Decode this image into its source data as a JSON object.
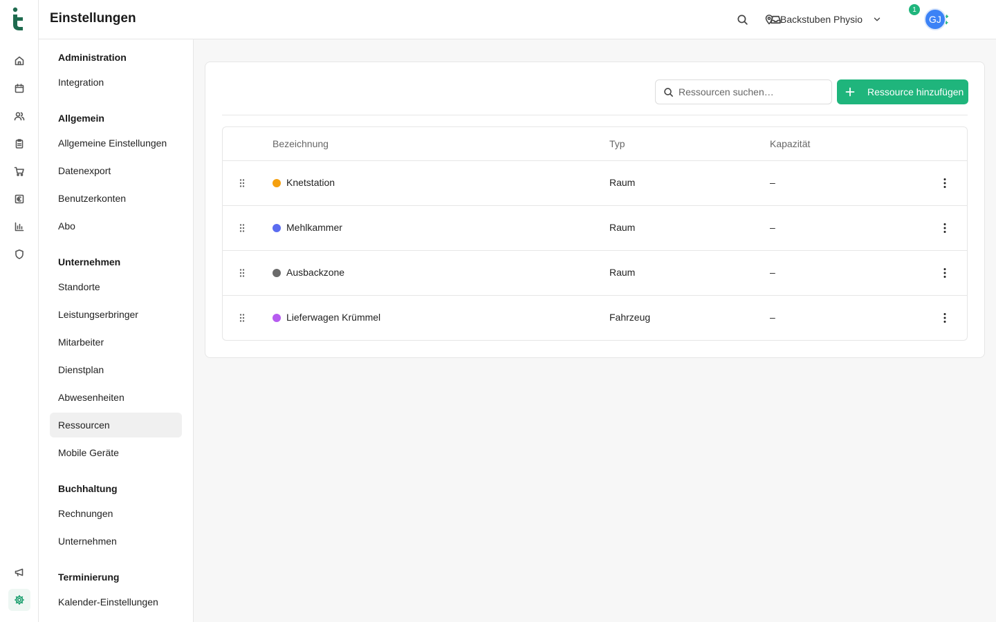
{
  "header": {
    "title": "Einstellungen",
    "location": "Backstuben Physio",
    "notification_count": "1",
    "avatar_initials": "GJ"
  },
  "rail": {
    "items": [
      "home-icon",
      "calendar-icon",
      "users-icon",
      "clipboard-icon",
      "cart-icon",
      "euro-icon",
      "chart-icon",
      "shield-icon",
      "megaphone-icon",
      "gear-icon"
    ]
  },
  "sidebar": {
    "sections": [
      {
        "title": "Administration",
        "items": [
          "Integration"
        ]
      },
      {
        "title": "Allgemein",
        "items": [
          "Allgemeine Einstellungen",
          "Datenexport",
          "Benutzerkonten",
          "Abo"
        ]
      },
      {
        "title": "Unternehmen",
        "items": [
          "Standorte",
          "Leistungserbringer",
          "Mitarbeiter",
          "Dienstplan",
          "Abwesenheiten",
          "Ressourcen",
          "Mobile Geräte"
        ]
      },
      {
        "title": "Buchhaltung",
        "items": [
          "Rechnungen",
          "Unternehmen"
        ]
      },
      {
        "title": "Terminierung",
        "items": [
          "Kalender-Einstellungen"
        ]
      }
    ],
    "active": "Ressourcen"
  },
  "resources": {
    "search_placeholder": "Ressourcen suchen…",
    "add_label": "Ressource hinzufügen",
    "columns": [
      "Bezeichnung",
      "Typ",
      "Kapazität"
    ],
    "rows": [
      {
        "name": "Knetstation",
        "type": "Raum",
        "capacity": "–",
        "color": "#f5a00f"
      },
      {
        "name": "Mehlkammer",
        "type": "Raum",
        "capacity": "–",
        "color": "#5b6cf0"
      },
      {
        "name": "Ausbackzone",
        "type": "Raum",
        "capacity": "–",
        "color": "#6b6b6b"
      },
      {
        "name": "Lieferwagen Krümmel",
        "type": "Fahrzeug",
        "capacity": "–",
        "color": "#b65cf0"
      }
    ]
  },
  "colors": {
    "accent": "#1fb57c",
    "avatar": "#3b82f6"
  }
}
